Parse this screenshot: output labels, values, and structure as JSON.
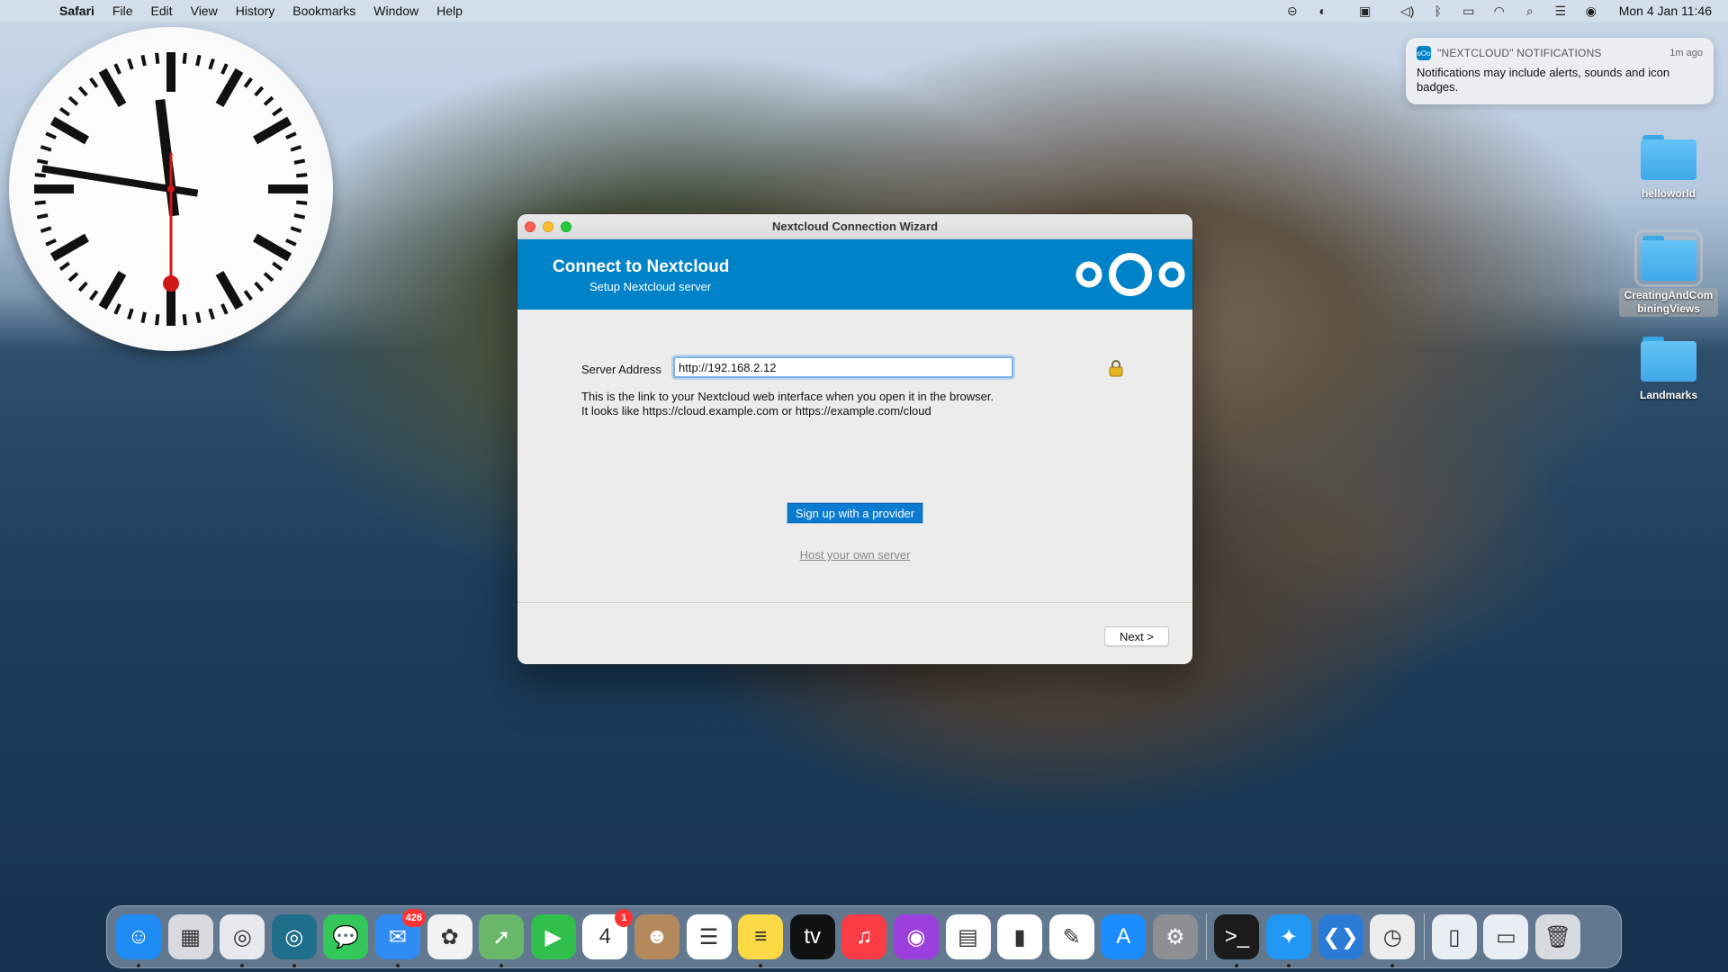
{
  "menubar": {
    "app_name": "Safari",
    "menus": [
      "File",
      "Edit",
      "View",
      "History",
      "Bookmarks",
      "Window",
      "Help"
    ],
    "status_icons": [
      "nextcloud-icon",
      "app-icon",
      "calendar-icon",
      "volume-icon",
      "bluetooth-icon",
      "battery-icon",
      "wifi-icon",
      "spotlight-icon",
      "control-center-icon",
      "siri-icon"
    ],
    "datetime": "Mon 4 Jan  11:46"
  },
  "clock_widget": {
    "hours": 11,
    "minutes": 46,
    "seconds": 30
  },
  "notification": {
    "app_name": "\"NEXTCLOUD\" NOTIFICATIONS",
    "time": "1m ago",
    "body": "Notifications may include alerts, sounds and icon badges."
  },
  "desktop_icons": [
    {
      "label": "helloworld"
    },
    {
      "label": "CreatingAndCombiningViews"
    },
    {
      "label": "Landmarks"
    }
  ],
  "window": {
    "title": "Nextcloud Connection Wizard",
    "banner_title": "Connect to Nextcloud",
    "banner_subtitle": "Setup Nextcloud server",
    "accent": "#0082c9",
    "server_label": "Server Address",
    "server_value": "http://192.168.2.12",
    "hint_line1": "This is the link to your Nextcloud web interface when you open it in the browser.",
    "hint_line2": "It looks like https://cloud.example.com or https://example.com/cloud",
    "signup_label": "Sign up with a provider",
    "host_label": "Host your own server",
    "next_label": "Next >"
  },
  "dock": {
    "items": [
      {
        "name": "finder",
        "color": "#1e8cf2",
        "glyph": "☺"
      },
      {
        "name": "launchpad",
        "color": "#d9d9e0",
        "glyph": "▦"
      },
      {
        "name": "app-ring-1",
        "color": "#e8e8ee",
        "glyph": "◎"
      },
      {
        "name": "app-ring-2",
        "color": "#1f6e8c",
        "glyph": "◎"
      },
      {
        "name": "messages",
        "color": "#34c759",
        "glyph": "💬"
      },
      {
        "name": "mail",
        "color": "#2f8cf5",
        "glyph": "✉",
        "badge": "426"
      },
      {
        "name": "photos",
        "color": "#f2f2f2",
        "glyph": "✿"
      },
      {
        "name": "maps",
        "color": "#69b86a",
        "glyph": "➚"
      },
      {
        "name": "facetime",
        "color": "#2fbf4a",
        "glyph": "▶"
      },
      {
        "name": "calendar",
        "color": "#ffffff",
        "glyph": "4",
        "badge": "1"
      },
      {
        "name": "contacts",
        "color": "#b48a5c",
        "glyph": "☻"
      },
      {
        "name": "reminders",
        "color": "#ffffff",
        "glyph": "☰"
      },
      {
        "name": "notes",
        "color": "#fbd945",
        "glyph": "≡"
      },
      {
        "name": "tv",
        "color": "#111111",
        "glyph": "tv"
      },
      {
        "name": "music",
        "color": "#fc3c44",
        "glyph": "♫"
      },
      {
        "name": "podcasts",
        "color": "#9b3fdd",
        "glyph": "◉"
      },
      {
        "name": "keynote",
        "color": "#ffffff",
        "glyph": "▤"
      },
      {
        "name": "numbers",
        "color": "#ffffff",
        "glyph": "▮"
      },
      {
        "name": "textedit",
        "color": "#ffffff",
        "glyph": "✎"
      },
      {
        "name": "app-store",
        "color": "#1a8cff",
        "glyph": "A"
      },
      {
        "name": "system-preferences",
        "color": "#8e8e93",
        "glyph": "⚙"
      },
      {
        "name": "terminal",
        "color": "#1b1b1b",
        "glyph": ">_"
      },
      {
        "name": "safari",
        "color": "#2196f3",
        "glyph": "✦"
      },
      {
        "name": "vscode",
        "color": "#2a7bd6",
        "glyph": "❮❯"
      },
      {
        "name": "clock",
        "color": "#ececec",
        "glyph": "◷"
      },
      {
        "name": "html-document",
        "color": "#e9eef5",
        "glyph": "▯"
      },
      {
        "name": "screenshot",
        "color": "#e9eef5",
        "glyph": "▭"
      },
      {
        "name": "trash",
        "color": "#d7dbe0",
        "glyph": "🗑"
      }
    ]
  }
}
